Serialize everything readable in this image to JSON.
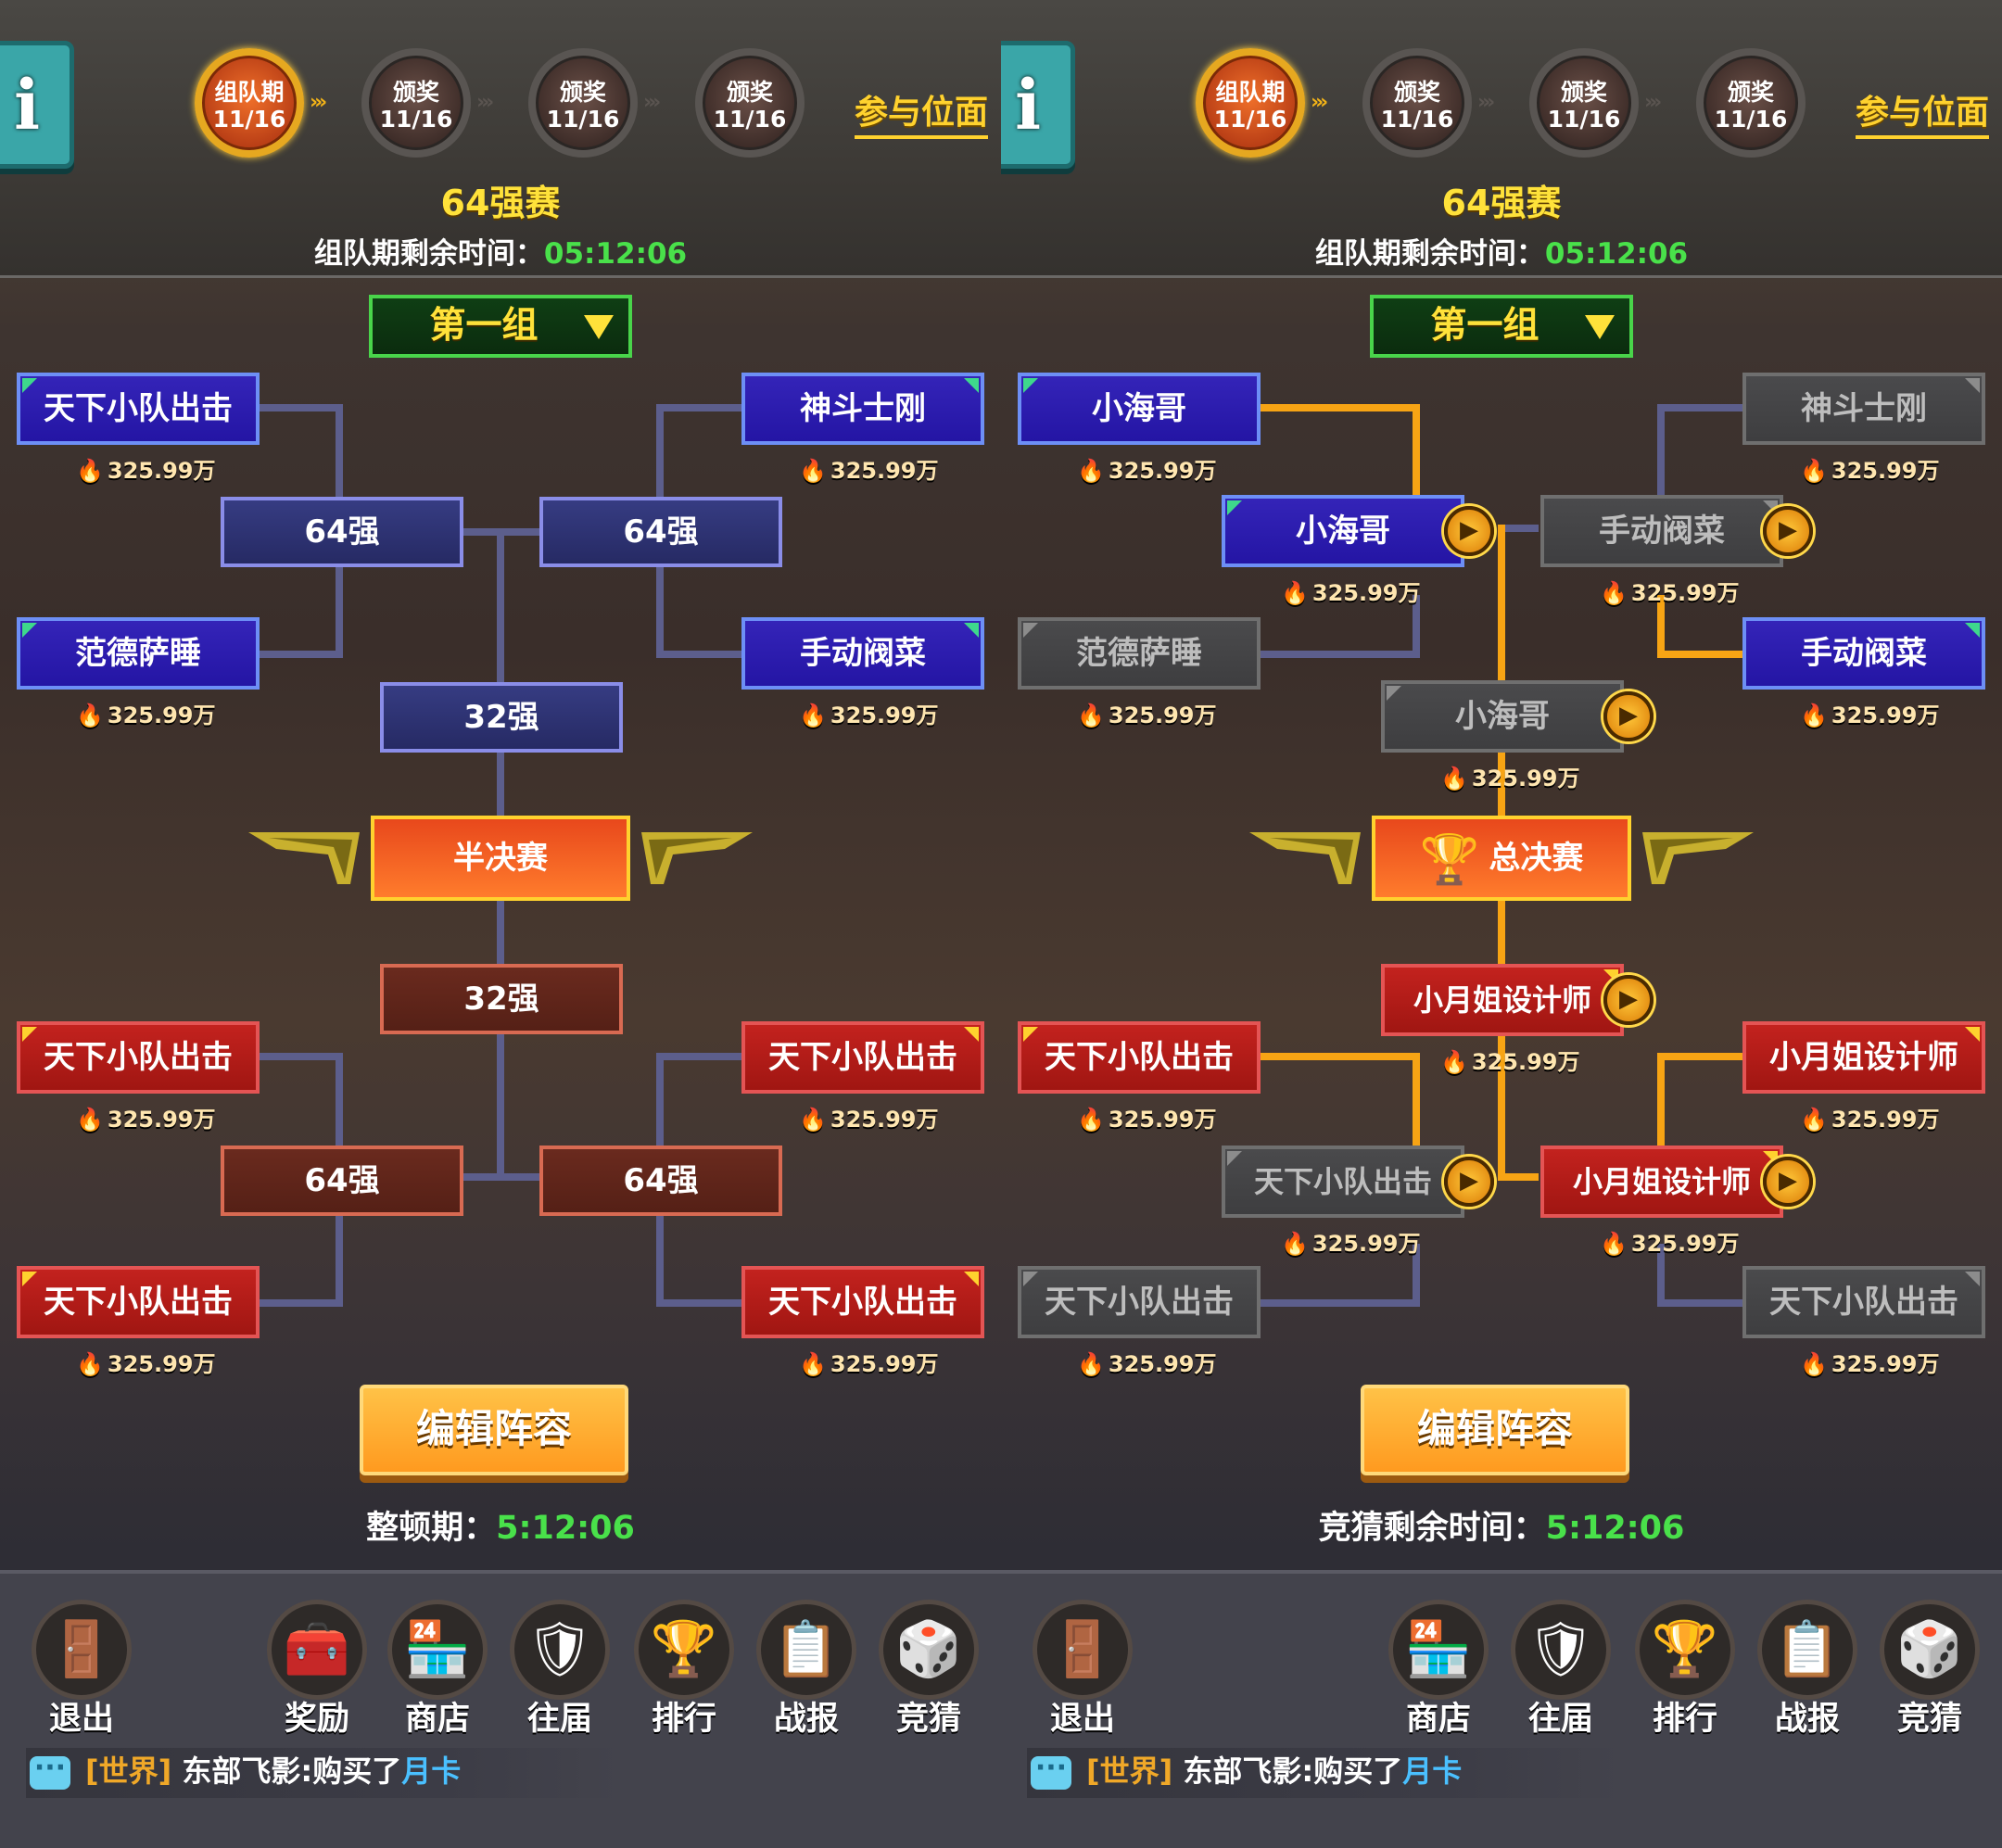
{
  "stages": [
    {
      "name": "组队期",
      "date": "11/16"
    },
    {
      "name": "颁奖",
      "date": "11/16"
    },
    {
      "name": "颁奖",
      "date": "11/16"
    },
    {
      "name": "颁奖",
      "date": "11/16"
    }
  ],
  "info_label": "i",
  "join_link": "参与位面",
  "round_title": "64强赛",
  "countdown_label": "组队期剩余时间：",
  "countdown_value": "05:12:06",
  "group_select": "第一组",
  "left": {
    "top_teams": [
      {
        "name": "天下小队出击",
        "power": "325.99万"
      },
      {
        "name": "范德萨睡",
        "power": "325.99万"
      },
      {
        "name": "神斗士刚",
        "power": "325.99万"
      },
      {
        "name": "手动阀菜",
        "power": "325.99万"
      }
    ],
    "bottom_teams": [
      {
        "name": "天下小队出击",
        "power": "325.99万"
      },
      {
        "name": "天下小队出击",
        "power": "325.99万"
      },
      {
        "name": "天下小队出击",
        "power": "325.99万"
      },
      {
        "name": "天下小队出击",
        "power": "325.99万"
      }
    ],
    "round_64": "64强",
    "round_32": "32强",
    "semi_label": "半决赛",
    "edit_button": "编辑阵容",
    "phase_label": "整顿期：",
    "phase_value": "5:12:06",
    "nav": [
      "退出",
      "奖励",
      "商店",
      "往届",
      "排行",
      "战报",
      "竞猜"
    ]
  },
  "right": {
    "top_teams": [
      {
        "name": "小海哥",
        "power": "325.99万"
      },
      {
        "name": "范德萨睡",
        "power": "325.99万"
      },
      {
        "name": "神斗士刚",
        "power": "325.99万"
      },
      {
        "name": "手动阀菜",
        "power": "325.99万"
      }
    ],
    "top_winners": [
      {
        "name": "小海哥",
        "power": "325.99万"
      },
      {
        "name": "手动阀菜",
        "power": "325.99万"
      }
    ],
    "top_final": {
      "name": "小海哥",
      "power": "325.99万"
    },
    "final_label": "总决赛",
    "bottom_final": {
      "name": "小月姐设计师",
      "power": "325.99万"
    },
    "bottom_winners": [
      {
        "name": "天下小队出击",
        "power": "325.99万"
      },
      {
        "name": "小月姐设计师",
        "power": "325.99万"
      }
    ],
    "bottom_teams": [
      {
        "name": "天下小队出击",
        "power": "325.99万"
      },
      {
        "name": "天下小队出击",
        "power": "325.99万"
      },
      {
        "name": "小月姐设计师",
        "power": "325.99万"
      },
      {
        "name": "天下小队出击",
        "power": "325.99万"
      }
    ],
    "edit_button": "编辑阵容",
    "phase_label": "竞猜剩余时间：",
    "phase_value": "5:12:06",
    "nav": [
      "退出",
      "商店",
      "往届",
      "排行",
      "战报",
      "竞猜"
    ]
  },
  "chat": {
    "channel": "[世界]",
    "text": "东部飞影:购买了",
    "highlight": "月卡"
  },
  "icons": {
    "exit": "exit-door-icon",
    "reward": "treasure-chest-icon",
    "shop": "shop-stall-icon",
    "history": "shield-crest-icon",
    "rank": "rank-trophy-icon",
    "report": "clipboard-report-icon",
    "guess": "mystery-box-icon",
    "play": "play-icon",
    "fire": "fire-icon",
    "trophy": "trophy-icon",
    "chat": "chat-bubble-icon"
  },
  "colors": {
    "accent_gold": "#ffd22e",
    "timer_green": "#49e14a",
    "blue_team": "#2415a4",
    "red_team": "#a01612",
    "bracket_gold": "#f7a414"
  }
}
